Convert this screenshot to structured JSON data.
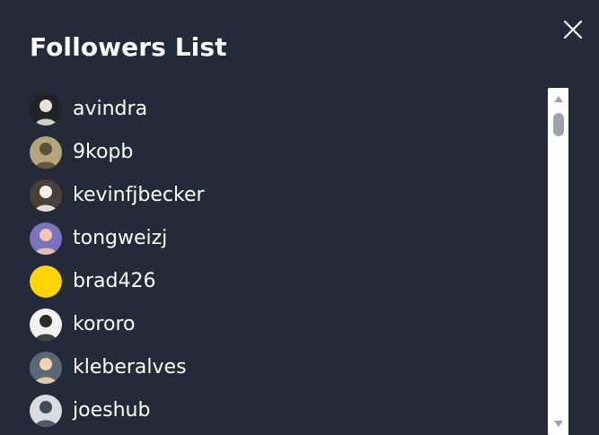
{
  "window": {
    "title": "Followers List",
    "close_icon": "close-icon"
  },
  "followers": [
    {
      "username": "avindra",
      "avatar": {
        "icon": "avatar-photo",
        "background": "#1f2226",
        "accent": "#e8e2d8"
      }
    },
    {
      "username": "9kopb",
      "avatar": {
        "icon": "avatar-photo",
        "background": "#b6a47a",
        "accent": "#5b4f3d"
      }
    },
    {
      "username": "kevinfjbecker",
      "avatar": {
        "icon": "avatar-photo",
        "background": "#494039",
        "accent": "#f3efe8"
      }
    },
    {
      "username": "tongweizj",
      "avatar": {
        "icon": "avatar-photo",
        "background": "#7a74bd",
        "accent": "#f0c7b2"
      }
    },
    {
      "username": "brad426",
      "avatar": {
        "icon": "avatar-solid",
        "background": "#ffd400",
        "accent": "#ffd400"
      }
    },
    {
      "username": "kororo",
      "avatar": {
        "icon": "avatar-photo",
        "background": "#f4f2ef",
        "accent": "#2b2b2b"
      }
    },
    {
      "username": "kleberalves",
      "avatar": {
        "icon": "avatar-photo",
        "background": "#5a6777",
        "accent": "#f2d0b0"
      }
    },
    {
      "username": "joeshub",
      "avatar": {
        "icon": "avatar-photo",
        "background": "#d9dde2",
        "accent": "#3f4b56"
      }
    }
  ],
  "scrollbar": {
    "up_icon": "scroll-up-icon",
    "down_icon": "scroll-down-icon"
  },
  "theme": {
    "background": "#232a38",
    "text": "#ffffff",
    "scroll_track": "#ffffff",
    "scroll_thumb": "#9ea3ab",
    "scroll_arrows": "#9ea3ab"
  }
}
